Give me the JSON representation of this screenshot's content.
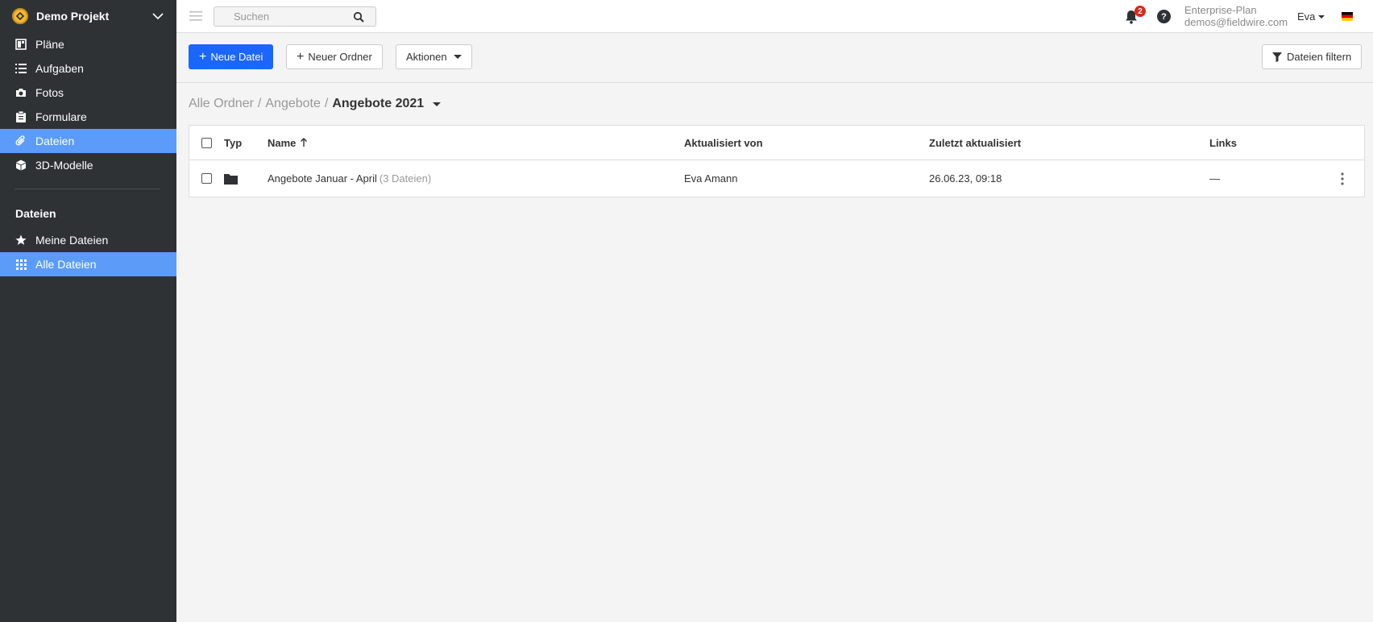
{
  "project": {
    "name": "Demo Projekt"
  },
  "sidebar": {
    "items": [
      {
        "label": "Pläne"
      },
      {
        "label": "Aufgaben"
      },
      {
        "label": "Fotos"
      },
      {
        "label": "Formulare"
      },
      {
        "label": "Dateien"
      },
      {
        "label": "3D-Modelle"
      }
    ],
    "section_title": "Dateien",
    "sub_items": [
      {
        "label": "Meine Dateien"
      },
      {
        "label": "Alle Dateien"
      }
    ]
  },
  "topbar": {
    "search_placeholder": "Suchen",
    "notification_count": "2",
    "help_glyph": "?",
    "plan_name": "Enterprise-Plan",
    "plan_email": "demos@fieldwire.com",
    "user_name": "Eva"
  },
  "toolbar": {
    "new_file": "Neue Datei",
    "new_folder": "Neuer Ordner",
    "actions": "Aktionen",
    "filter": "Dateien filtern"
  },
  "breadcrumb": {
    "level1": "Alle Ordner",
    "level2": "Angebote",
    "current": "Angebote 2021",
    "separator": "/"
  },
  "table": {
    "headers": {
      "type": "Typ",
      "name": "Name",
      "updated_by": "Aktualisiert von",
      "last_updated": "Zuletzt aktualisiert",
      "links": "Links"
    },
    "rows": [
      {
        "name": "Angebote Januar - April",
        "count": "(3 Dateien)",
        "updated_by": "Eva Amann",
        "last_updated": "26.06.23, 09:18",
        "links": "—"
      }
    ]
  },
  "colors": {
    "sidebar_bg": "#2e3235",
    "active_item": "#5c9cf8",
    "primary_button": "#1a66ff",
    "badge": "#e0261a"
  }
}
